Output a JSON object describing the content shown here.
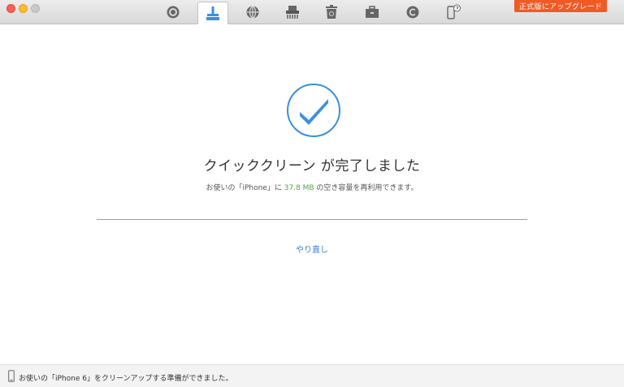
{
  "window": {
    "controls": [
      "close",
      "minimize",
      "maximize"
    ]
  },
  "toolbar": {
    "tools": [
      {
        "icon": "target-icon",
        "active": false
      },
      {
        "icon": "broom-icon",
        "active": true
      },
      {
        "icon": "globe-icon",
        "active": false
      },
      {
        "icon": "shredder-icon",
        "active": false
      },
      {
        "icon": "recycle-bin-icon",
        "active": false
      },
      {
        "icon": "toolbox-icon",
        "active": false
      },
      {
        "icon": "copyright-icon",
        "active": false
      },
      {
        "icon": "phone-help-icon",
        "active": false
      }
    ],
    "upgrade_label": "正式版にアップグレード",
    "accent": "#3b8fe0",
    "upgrade_color": "#f15a24"
  },
  "main": {
    "status_icon": "checkmark-icon",
    "title": "クイッククリーン が完了しました",
    "subtitle_prefix": "お使いの「iPhone」に ",
    "subtitle_size": "37.8 MB",
    "subtitle_suffix": " の空き容量を再利用できます。",
    "size_color": "#55a83b",
    "retry_label": "やり直し"
  },
  "statusbar": {
    "icon": "iphone-icon",
    "message": "お使いの「iPhone 6」をクリーンアップする準備ができました。"
  }
}
